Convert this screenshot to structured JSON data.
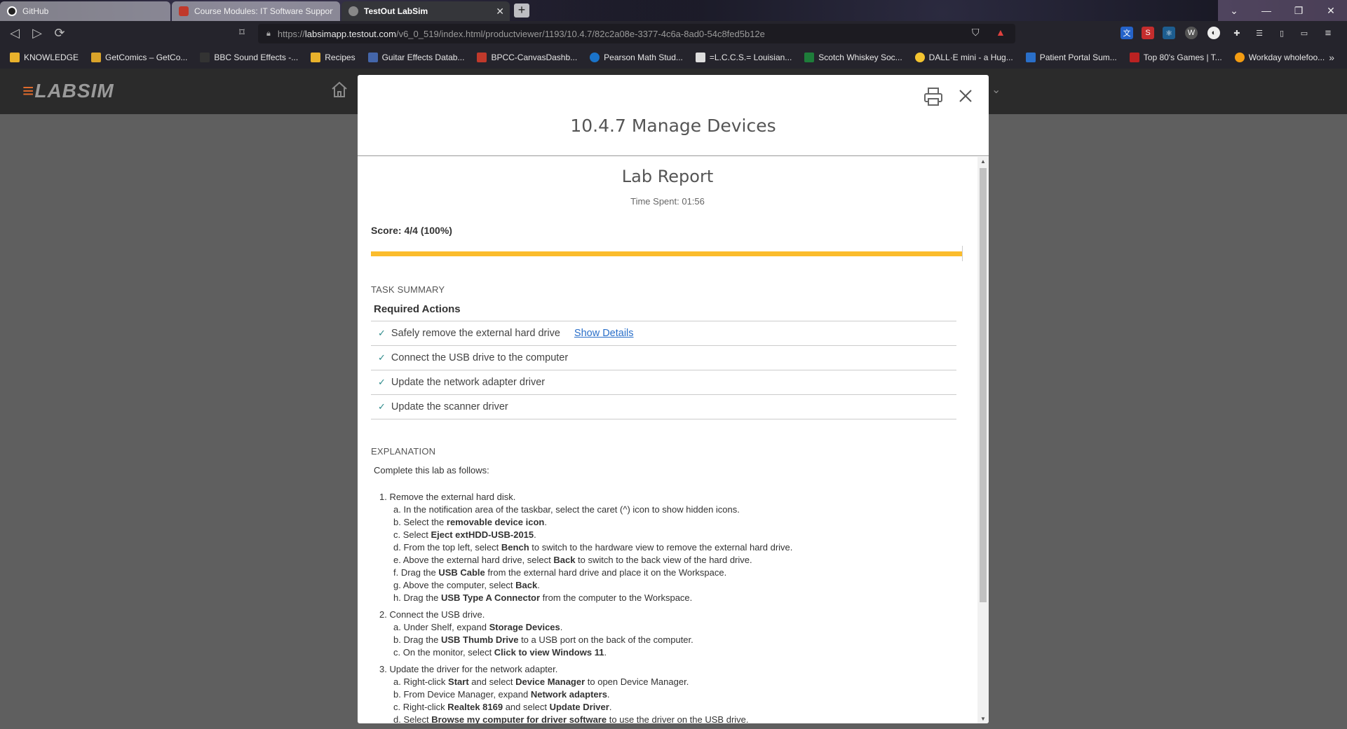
{
  "browser": {
    "tabs": [
      {
        "title": "GitHub",
        "state": "inactive"
      },
      {
        "title": "Course Modules: IT Software Support",
        "state": "inactive"
      },
      {
        "title": "TestOut LabSim",
        "state": "active"
      }
    ],
    "new_tab": "+",
    "url_prefix": "https://",
    "url_host": "labsimapp.testout.com",
    "url_path": "/v6_0_519/index.html/productviewer/1193/10.4.7/82c2a08e-3377-4c6a-8ad0-54c8fed5b12e",
    "bookmarks": [
      "KNOWLEDGE",
      "GetComics – GetCo...",
      "BBC Sound Effects -...",
      "Recipes",
      "Guitar Effects Datab...",
      "BPCC-CanvasDashb...",
      "Pearson Math Stud...",
      "=L.C.C.S.= Louisian...",
      "Scotch Whiskey Soc...",
      "DALL·E mini - a Hug...",
      "Patient Portal Sum...",
      "Top 80's Games | T...",
      "Workday wholefoo..."
    ],
    "more_bookmarks": "»"
  },
  "app": {
    "logo": "LABSIM"
  },
  "modal": {
    "title": "10.4.7 Manage Devices",
    "report_title": "Lab Report",
    "time_spent": "Time Spent: 01:56",
    "score": "Score: 4/4 (100%)",
    "score_fraction": 1.0,
    "task_summary_label": "TASK SUMMARY",
    "required_actions_label": "Required Actions",
    "tasks": [
      {
        "label": "Safely remove the external hard drive",
        "done": true,
        "link": "Show Details"
      },
      {
        "label": "Connect the USB drive to the computer",
        "done": true
      },
      {
        "label": "Update the network adapter driver",
        "done": true
      },
      {
        "label": "Update the scanner driver",
        "done": true
      }
    ],
    "explanation_label": "EXPLANATION",
    "explanation_intro": "Complete this lab as follows:",
    "steps": [
      {
        "title": "1. Remove the external hard disk.",
        "subs": [
          [
            "a. In the notification area of the taskbar, select the caret (^) icon to show hidden icons."
          ],
          [
            "b. Select the ",
            "removable device icon",
            "."
          ],
          [
            "c. Select ",
            "Eject extHDD-USB-2015",
            "."
          ],
          [
            "d. From the top left, select ",
            "Bench",
            " to switch to the hardware view to remove the external hard drive."
          ],
          [
            "e. Above the external hard drive, select ",
            "Back",
            " to switch to the back view of the hard drive."
          ],
          [
            "f. Drag the ",
            "USB Cable",
            " from the external hard drive and place it on the Workspace."
          ],
          [
            "g. Above the computer, select ",
            "Back",
            "."
          ],
          [
            "h. Drag the ",
            "USB Type A Connector",
            " from the computer to the Workspace."
          ]
        ]
      },
      {
        "title": "2. Connect the USB drive.",
        "subs": [
          [
            "a. Under Shelf, expand ",
            "Storage Devices",
            "."
          ],
          [
            "b. Drag the ",
            "USB Thumb Drive",
            " to a USB port on the back of the computer."
          ],
          [
            "c. On the monitor, select ",
            "Click to view Windows 11",
            "."
          ]
        ]
      },
      {
        "title": "3. Update the driver for the network adapter.",
        "subs": [
          [
            "a. Right-click ",
            "Start",
            " and select ",
            "Device Manager",
            " to open Device Manager."
          ],
          [
            "b. From Device Manager, expand ",
            "Network adapters",
            "."
          ],
          [
            "c. Right-click ",
            "Realtek 8169",
            " and select ",
            "Update Driver",
            "."
          ],
          [
            "d. Select ",
            "Browse my computer for driver software",
            " to use the driver on the USB drive."
          ]
        ]
      }
    ]
  },
  "colors": {
    "progress": "#fbbc2c",
    "check": "#2c8a8a",
    "link": "#2a6fc9"
  }
}
